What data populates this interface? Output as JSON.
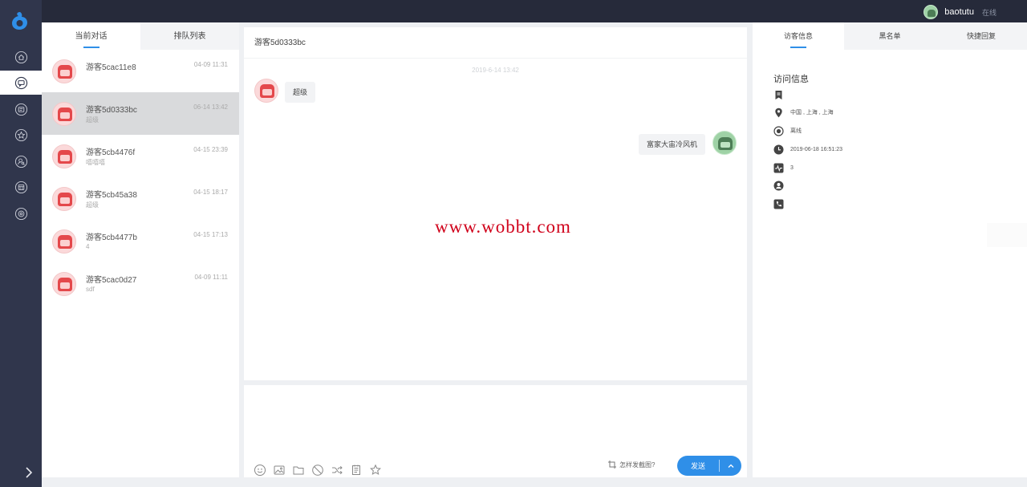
{
  "topbar": {
    "user": {
      "name": "baotutu",
      "status": "在线"
    }
  },
  "sidebar": {
    "items": [
      {
        "icon": "home-icon"
      },
      {
        "icon": "chat-icon",
        "active": true
      },
      {
        "icon": "queue-icon"
      },
      {
        "icon": "star-icon"
      },
      {
        "icon": "user-search-icon"
      },
      {
        "icon": "database-icon"
      },
      {
        "icon": "settings-icon"
      }
    ],
    "expand_icon": "chevron-right-icon"
  },
  "conversations": {
    "tabs": [
      "当前对话",
      "排队列表"
    ],
    "items": [
      {
        "name": "游客5cac11e8",
        "time": "04-09 11:31",
        "msg": ""
      },
      {
        "name": "游客5d0333bc",
        "time": "06-14 13:42",
        "msg": "超级",
        "selected": true
      },
      {
        "name": "游客5cb4476f",
        "time": "04-15 23:39",
        "msg": "嘻嘻嘻"
      },
      {
        "name": "游客5cb45a38",
        "time": "04-15 18:17",
        "msg": "超级"
      },
      {
        "name": "游客5cb4477b",
        "time": "04-15 17:13",
        "msg": "4"
      },
      {
        "name": "游客5cac0d27",
        "time": "04-09 11:11",
        "msg": "sdf"
      }
    ]
  },
  "chat": {
    "title": "游客5d0333bc",
    "date": "2019-6-14 13:42",
    "messages": [
      {
        "side": "left",
        "text": "超级"
      },
      {
        "side": "right",
        "text": "富家大宙冷风机"
      }
    ],
    "watermark": "www.wobbt.com"
  },
  "editor": {
    "tools": [
      "emoji-icon",
      "image-icon",
      "folder-icon",
      "block-icon",
      "transfer-icon",
      "note-icon",
      "star-icon"
    ],
    "screenshot_tip": "怎样发截图?",
    "send_label": "发送"
  },
  "right_panel": {
    "tabs": [
      "访客信息",
      "黑名单",
      "快捷回复"
    ],
    "info_title": "访问信息",
    "rows": [
      {
        "icon": "bookmark-icon",
        "text": ""
      },
      {
        "icon": "location-icon",
        "text": "中国 , 上海 , 上海"
      },
      {
        "icon": "status-icon",
        "text": "离线"
      },
      {
        "icon": "clock-icon",
        "text": "2019-06-18 16:51:23"
      },
      {
        "icon": "activity-icon",
        "text": "3"
      },
      {
        "icon": "person-icon",
        "text": ""
      },
      {
        "icon": "phone-icon",
        "text": ""
      }
    ]
  },
  "colors": {
    "sidebar": "#30364c",
    "topbar": "#262a3a",
    "accent": "#2f8fe8",
    "watermark": "#d0021b"
  }
}
